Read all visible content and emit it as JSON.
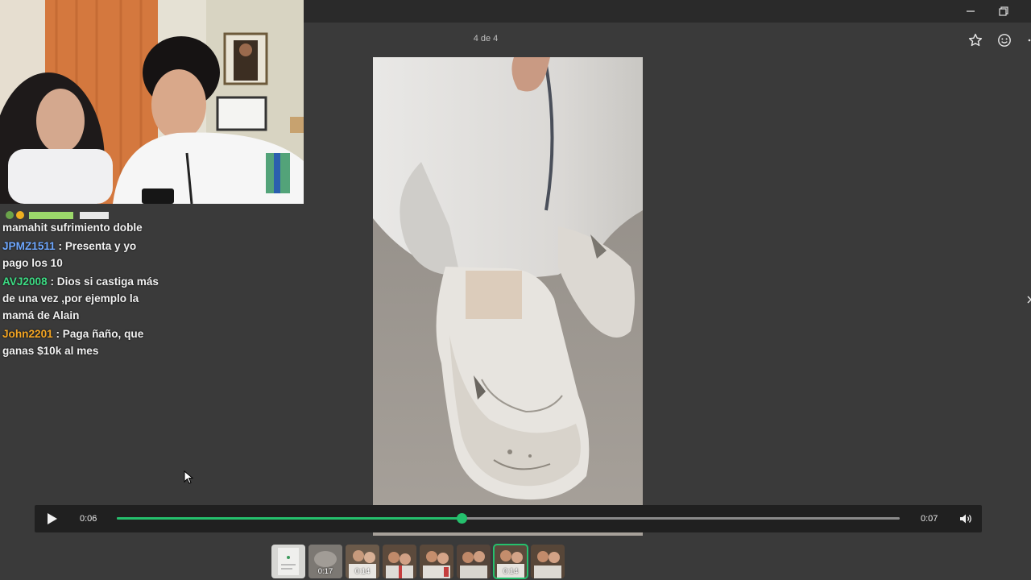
{
  "viewer": {
    "counter": "4 de 4",
    "icons": {
      "favorite": "star-icon",
      "react": "smiley-icon",
      "more": "more-dots-icon",
      "next": "chevron-right-icon"
    }
  },
  "window": {
    "minimize": "minimize-icon",
    "restore": "restore-icon"
  },
  "chat": {
    "messages": [
      {
        "user": "",
        "text": "mamahit sufrimiento doble",
        "color": "#9bd86a"
      },
      {
        "user": "JPMZ1511",
        "text": ": Presenta y yo pago los 10",
        "color": "#6fa8ff"
      },
      {
        "user": "AVJ2008",
        "text": ": Dios si castiga más de una vez ,por ejemplo la mamá de Alain",
        "color": "#3ddc84"
      },
      {
        "user": "John2201",
        "text": ": Paga ñaño, que ganas $10k al mes",
        "color": "#f5a623"
      }
    ]
  },
  "player": {
    "current_time": "0:06",
    "total_time": "0:07",
    "progress": 0.44,
    "accent_color": "#25c06d",
    "icons": {
      "play": "play-icon",
      "volume": "volume-icon"
    }
  },
  "thumbnails": [
    {
      "duration": ""
    },
    {
      "duration": "0:17"
    },
    {
      "duration": "0:14"
    },
    {
      "duration": ""
    },
    {
      "duration": ""
    },
    {
      "duration": ""
    },
    {
      "duration": "0:14"
    },
    {
      "duration": ""
    }
  ]
}
